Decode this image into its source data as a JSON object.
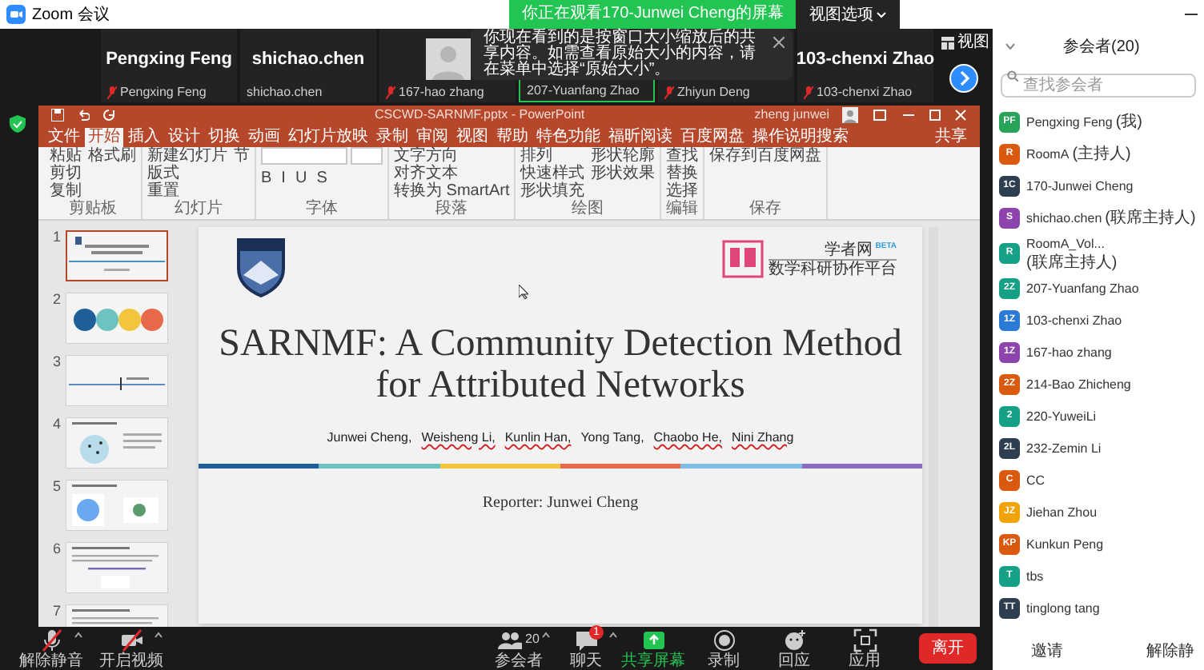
{
  "window": {
    "title": "Zoom 会议"
  },
  "share_banner": {
    "text": "你正在观看170-Junwei Cheng的屏幕",
    "view_options": "视图选项"
  },
  "video_strip": {
    "view_button": "视图",
    "tiles": [
      {
        "name": "Pengxing Feng",
        "label": "Pengxing Feng",
        "muted": true,
        "avatar": false,
        "active": false
      },
      {
        "name": "shichao.chen",
        "label": "shichao.chen",
        "muted": false,
        "avatar": false,
        "active": false
      },
      {
        "label": "167-hao zhang",
        "muted": true,
        "avatar": true,
        "active": false
      },
      {
        "label": "207-Yuanfang Zhao",
        "muted": false,
        "avatar": false,
        "active": true
      },
      {
        "label": "Zhiyun Deng",
        "muted": true,
        "avatar": false,
        "active": false
      },
      {
        "name": "103-chenxi Zhao",
        "label": "103-chenxi Zhao",
        "muted": true,
        "avatar": false,
        "active": false
      }
    ]
  },
  "tooltip": {
    "text": "你现在看到的是按窗口大小缩放后的共享内容。如需查看原始大小的内容，请在菜单中选择“原始大小”。"
  },
  "powerpoint": {
    "title": "CSCWD-SARNMF.pptx - PowerPoint",
    "user": "zheng junwei",
    "share": "共享",
    "tabs": [
      {
        "label": "文件",
        "selected": false
      },
      {
        "label": "开始",
        "selected": true
      },
      {
        "label": "插入",
        "selected": false
      },
      {
        "label": "设计",
        "selected": false
      },
      {
        "label": "切换",
        "selected": false
      },
      {
        "label": "动画",
        "selected": false
      },
      {
        "label": "幻灯片放映",
        "selected": false
      },
      {
        "label": "录制",
        "selected": false
      },
      {
        "label": "审阅",
        "selected": false
      },
      {
        "label": "视图",
        "selected": false
      },
      {
        "label": "帮助",
        "selected": false
      },
      {
        "label": "特色功能",
        "selected": false
      },
      {
        "label": "福昕阅读",
        "selected": false
      },
      {
        "label": "百度网盘",
        "selected": false
      },
      {
        "label": "操作说明搜索",
        "selected": false
      }
    ],
    "ribbon_groups": [
      {
        "label": "剪贴板",
        "items": [
          "粘贴",
          "剪切",
          "复制",
          "格式刷"
        ]
      },
      {
        "label": "幻灯片",
        "items": [
          "新建幻灯片",
          "版式",
          "重置",
          "节"
        ]
      },
      {
        "label": "字体",
        "items": [
          "B",
          "I",
          "U",
          "S"
        ]
      },
      {
        "label": "段落",
        "items": [
          "文字方向",
          "对齐文本",
          "转换为 SmartArt"
        ]
      },
      {
        "label": "绘图",
        "items": [
          "排列",
          "快速样式",
          "形状填充",
          "形状轮廓",
          "形状效果"
        ]
      },
      {
        "label": "编辑",
        "items": [
          "查找",
          "替换",
          "选择"
        ]
      },
      {
        "label": "保存",
        "items": [
          "保存到百度网盘"
        ]
      }
    ],
    "slides": [
      {
        "number": "1",
        "selected": true,
        "kind": "title"
      },
      {
        "number": "2",
        "selected": false,
        "kind": "circles"
      },
      {
        "number": "3",
        "selected": false,
        "kind": "timeline"
      },
      {
        "number": "4",
        "selected": false,
        "kind": "scatter"
      },
      {
        "number": "5",
        "selected": false,
        "kind": "figures"
      },
      {
        "number": "6",
        "selected": false,
        "kind": "text"
      },
      {
        "number": "7",
        "selected": false,
        "kind": "text"
      }
    ],
    "slide": {
      "title": "SARNMF: A Community Detection Method for Attributed Networks",
      "authors": [
        {
          "name": "Junwei Cheng,",
          "flagged": false
        },
        {
          "name": "Weisheng Li,",
          "flagged": true
        },
        {
          "name": "Kunlin Han,",
          "flagged": true
        },
        {
          "name": "Yong Tang,",
          "flagged": false
        },
        {
          "name": "Chaobo He,",
          "flagged": true
        },
        {
          "name": "Nini Zhang",
          "flagged": true
        }
      ],
      "reporter": "Reporter: Junwei Cheng",
      "logo_name": "学者网",
      "logo_badge": "BETA",
      "logo_caption": "数学科研协作平台"
    }
  },
  "participants": {
    "title": "参会者(20)",
    "search": {
      "placeholder": "查找参会者"
    },
    "people": [
      {
        "initials": "PF",
        "name": "Pengxing Feng",
        "role": "(我)",
        "color": "#27a35a"
      },
      {
        "initials": "R",
        "name": "RoomA",
        "role": "(主持人)",
        "color": "#d9590f"
      },
      {
        "initials": "1C",
        "name": "170-Junwei Cheng",
        "color": "#2d3e50"
      },
      {
        "initials": "S",
        "name": "shichao.chen",
        "role": "(联席主持人)",
        "color": "#8e44ad"
      },
      {
        "initials": "R",
        "name": "RoomA_Vol...",
        "role": "(联席主持人)",
        "color": "#16a085"
      },
      {
        "initials": "2Z",
        "name": "207-Yuanfang Zhao",
        "color": "#16a085"
      },
      {
        "initials": "1Z",
        "name": "103-chenxi Zhao",
        "color": "#2b7bd6"
      },
      {
        "initials": "1Z",
        "name": "167-hao zhang",
        "color": "#8e44ad"
      },
      {
        "initials": "2Z",
        "name": "214-Bao Zhicheng",
        "color": "#d9590f"
      },
      {
        "initials": "2",
        "name": "220-YuweiLi",
        "color": "#16a085"
      },
      {
        "initials": "2L",
        "name": "232-Zemin Li",
        "color": "#2d3e50"
      },
      {
        "initials": "C",
        "name": "CC",
        "color": "#d9590f"
      },
      {
        "initials": "JZ",
        "name": "Jiehan Zhou",
        "color": "#f0a30a"
      },
      {
        "initials": "KP",
        "name": "Kunkun Peng",
        "color": "#d9590f"
      },
      {
        "initials": "T",
        "name": "tbs",
        "color": "#16a085"
      },
      {
        "initials": "TT",
        "name": "tinglong tang",
        "color": "#2d3e50"
      }
    ],
    "buttons": [
      "邀请",
      "解除静"
    ]
  },
  "toolbar": {
    "left": [
      {
        "kind": "mic",
        "label": "解除静音"
      },
      {
        "kind": "video",
        "label": "开启视频"
      }
    ],
    "center": [
      {
        "kind": "people",
        "label": "参会者",
        "count": "20"
      },
      {
        "kind": "chat",
        "label": "聊天",
        "badge": "1"
      },
      {
        "kind": "share",
        "label": "共享屏幕"
      },
      {
        "kind": "record",
        "label": "录制"
      },
      {
        "kind": "react",
        "label": "回应"
      },
      {
        "kind": "apps",
        "label": "应用"
      }
    ],
    "leave": "离开"
  }
}
